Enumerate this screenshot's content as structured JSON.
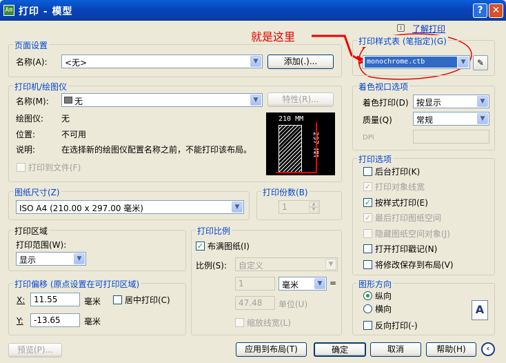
{
  "titlebar": {
    "title": "打印 - 模型",
    "help": "?",
    "close": "✕",
    "app_icon": "A≡"
  },
  "annotation": {
    "text": "就是这里"
  },
  "help_link": {
    "icon": "i",
    "text": "了解打印"
  },
  "page_setup": {
    "group": "页面设置",
    "name_label": "名称(A):",
    "name_value": "<无>",
    "add_button": "添加(.)..."
  },
  "printer": {
    "group": "打印机/绘图仪",
    "name_label": "名称(M):",
    "name_value": "无",
    "properties_button": "特性(R)...",
    "plotter_label": "绘图仪:",
    "plotter_value": "无",
    "location_label": "位置:",
    "location_value": "不可用",
    "desc_label": "说明:",
    "desc_value": "在选择新的绘图仪配置名称之前，不能打印该布局。",
    "print_to_file": "打印到文件(F)"
  },
  "preview": {
    "width": "210 MM",
    "height": "297 MM"
  },
  "paper_size": {
    "group": "图纸尺寸(Z)",
    "value": "ISO A4 (210.00 x 297.00 毫米)"
  },
  "copies": {
    "group": "打印份数(B)",
    "value": "1"
  },
  "plot_area": {
    "group": "打印区域",
    "range_label": "打印范围(W):",
    "range_value": "显示"
  },
  "plot_offset": {
    "group": "打印偏移 (原点设置在可打印区域)",
    "x_label": "X:",
    "x_value": "11.55",
    "y_label": "Y:",
    "y_value": "-13.65",
    "unit": "毫米",
    "center": "居中打印(C)"
  },
  "plot_scale": {
    "group": "打印比例",
    "fit": "布满图纸(I)",
    "scale_label": "比例(S):",
    "scale_value": "自定义",
    "num_value": "1",
    "unit_value": "毫米",
    "equals": "=",
    "den_value": "47.48",
    "den_unit": "单位(U)",
    "lineweights": "缩放线宽(L)"
  },
  "plot_style": {
    "group": "打印样式表 (笔指定)(G)",
    "value": "monochrome.ctb",
    "edit_icon": "✎"
  },
  "shaded": {
    "group": "着色视口选项",
    "shade_label": "着色打印(D)",
    "shade_value": "按显示",
    "quality_label": "质量(Q)",
    "quality_value": "常规",
    "dpi_label": "DPI"
  },
  "options": {
    "group": "打印选项",
    "items": [
      "后台打印(K)",
      "打印对象线宽",
      "按样式打印(E)",
      "最后打印图纸空间",
      "隐藏图纸空间对象(J)",
      "打开打印戳记(N)",
      "将修改保存到布局(V)"
    ]
  },
  "orientation": {
    "group": "图形方向",
    "portrait": "纵向",
    "landscape": "横向",
    "reverse": "反向打印(-)",
    "icon": "A"
  },
  "buttons": {
    "preview": "预览(P)...",
    "apply": "应用到布局(T)",
    "ok": "确定",
    "cancel": "取消",
    "help": "帮助(H)",
    "collapse": "‹"
  }
}
